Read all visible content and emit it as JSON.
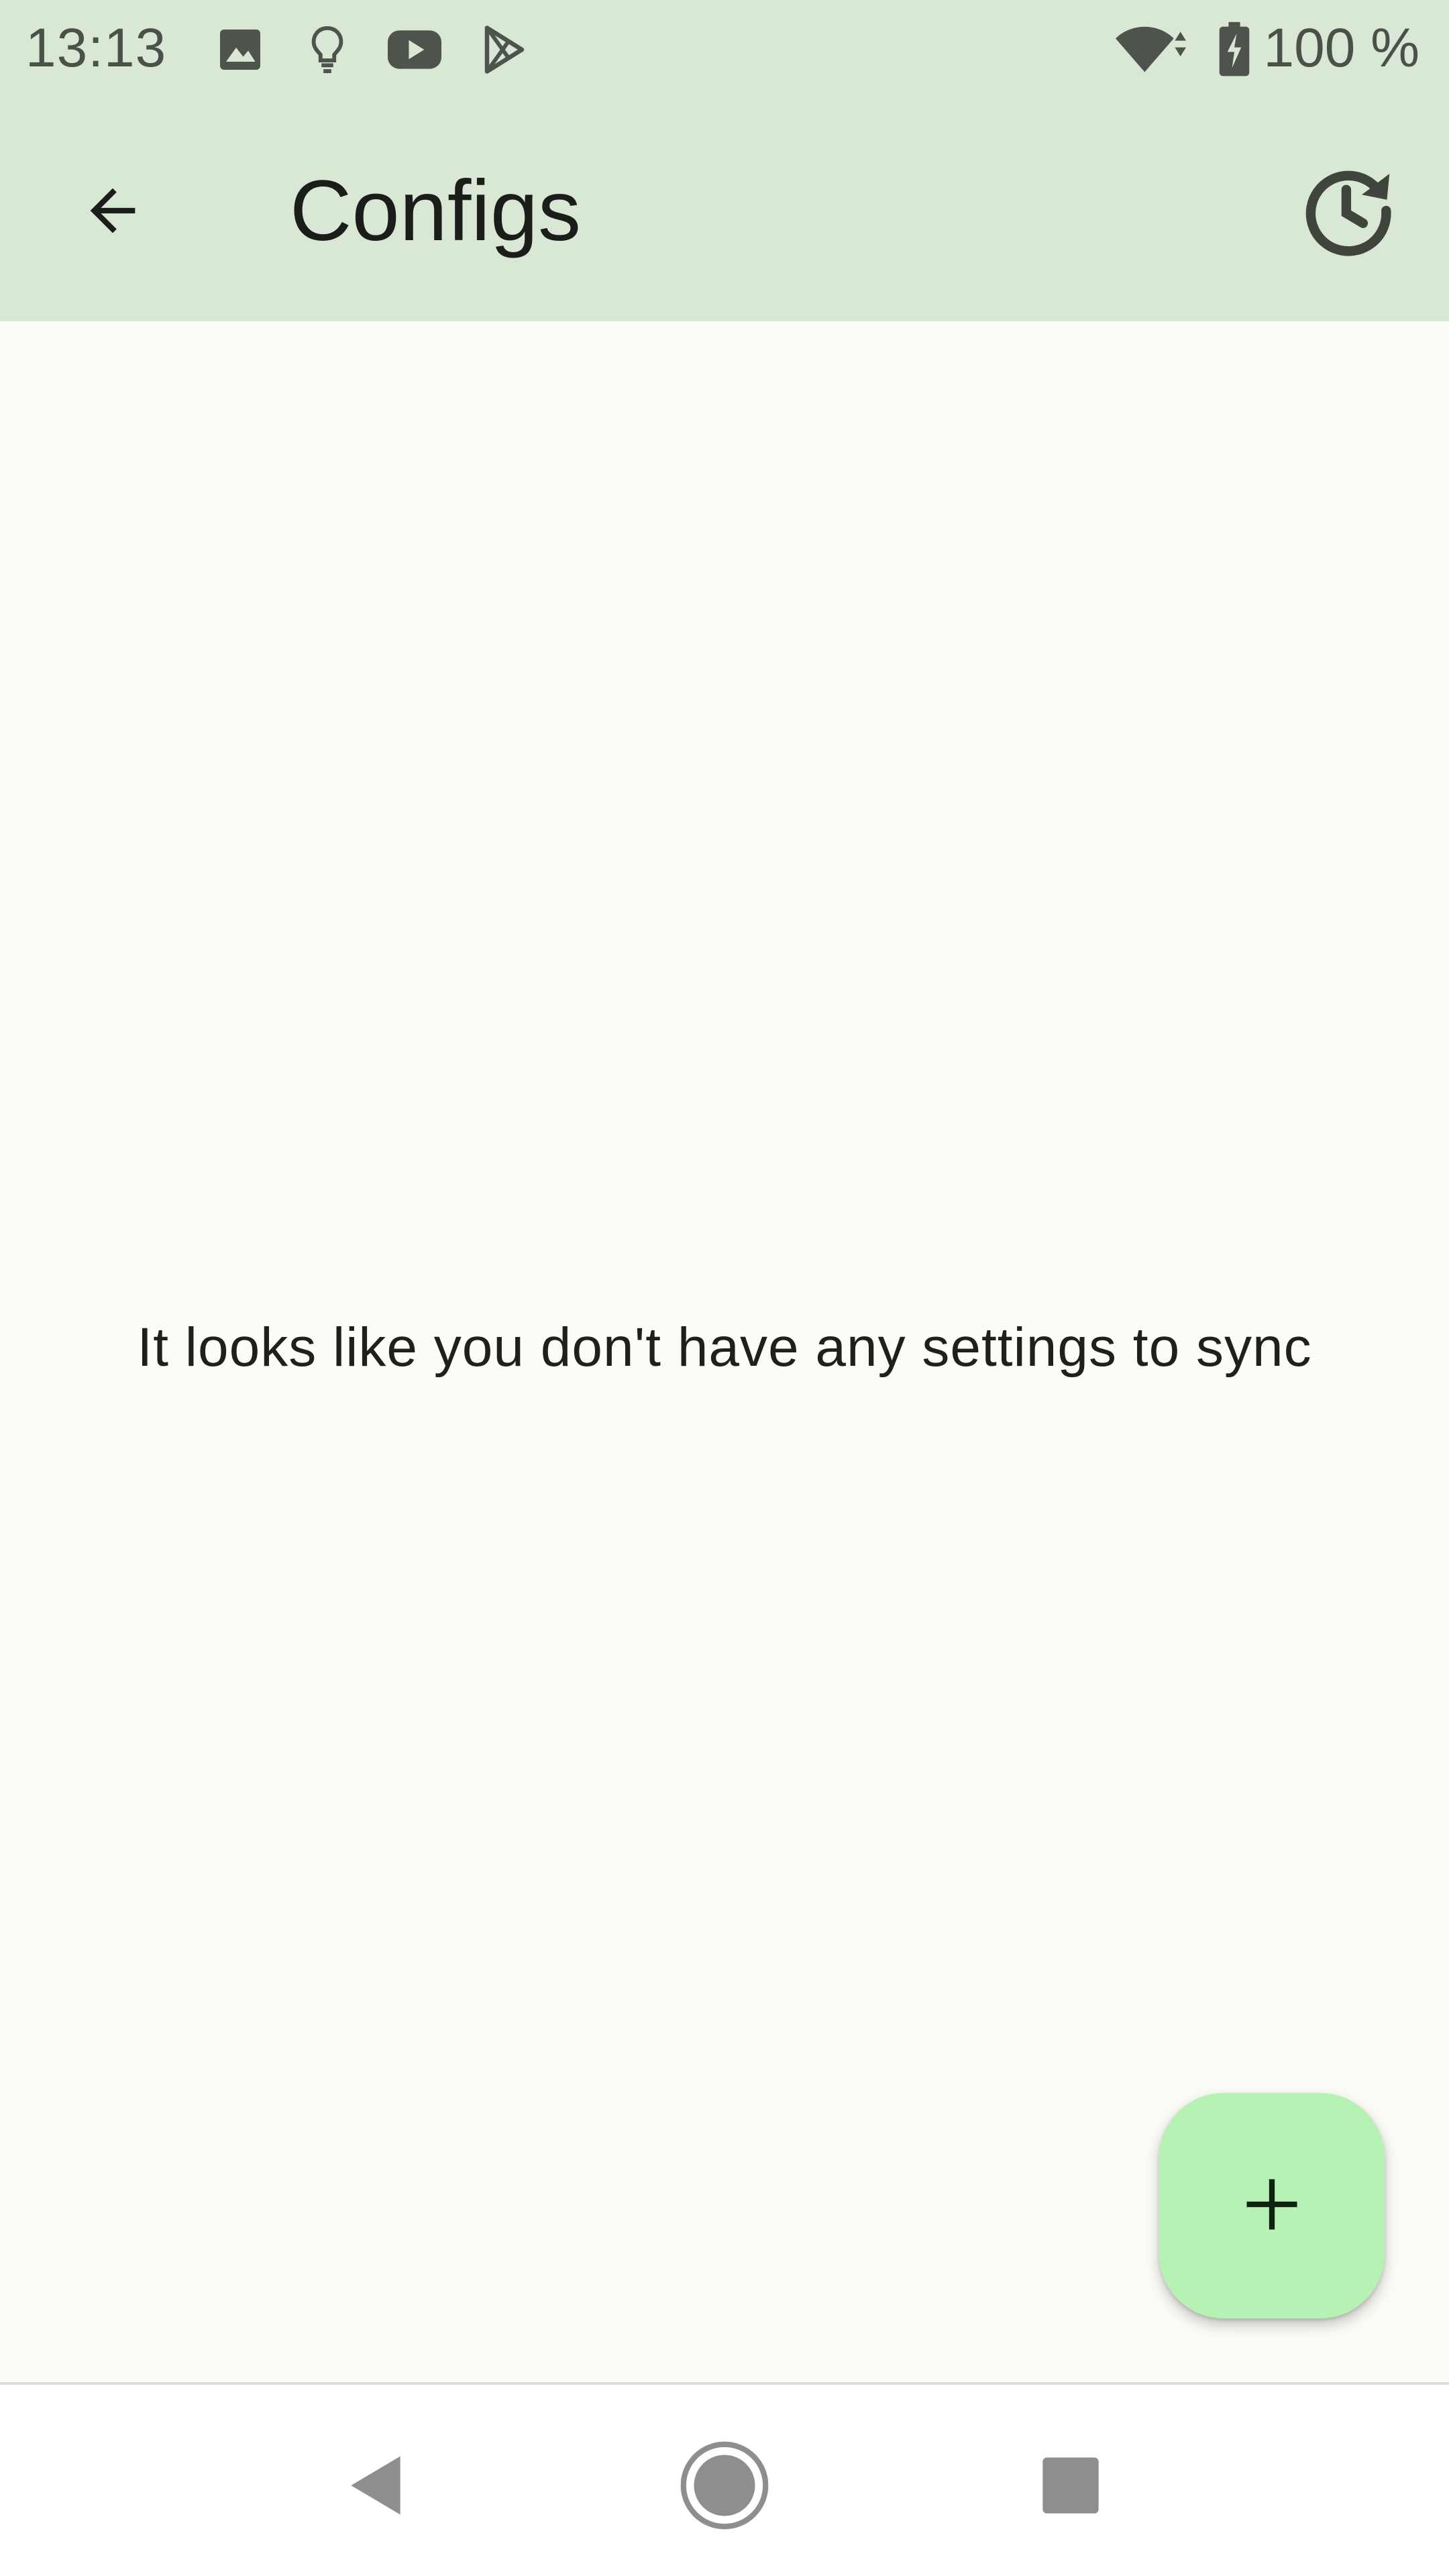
{
  "status_bar": {
    "time": "13:13",
    "battery_text": "100 %",
    "icons": [
      "image-icon",
      "lightbulb-icon",
      "youtube-icon",
      "play-store-icon",
      "wifi-icon",
      "battery-charging-icon"
    ]
  },
  "app_bar": {
    "title": "Configs",
    "back_icon": "arrow-back-icon",
    "history_icon": "history-clock-icon"
  },
  "content": {
    "empty_message": "It looks like you don't have any settings to sync"
  },
  "fab": {
    "icon": "plus-icon"
  },
  "nav_bar": {
    "icons": [
      "nav-back-icon",
      "nav-home-icon",
      "nav-recents-icon"
    ]
  },
  "colors": {
    "top_bar": "#d8e8d5",
    "background": "#fbfcf7",
    "fab": "#b6f2b4",
    "text": "#1b1d1a"
  }
}
